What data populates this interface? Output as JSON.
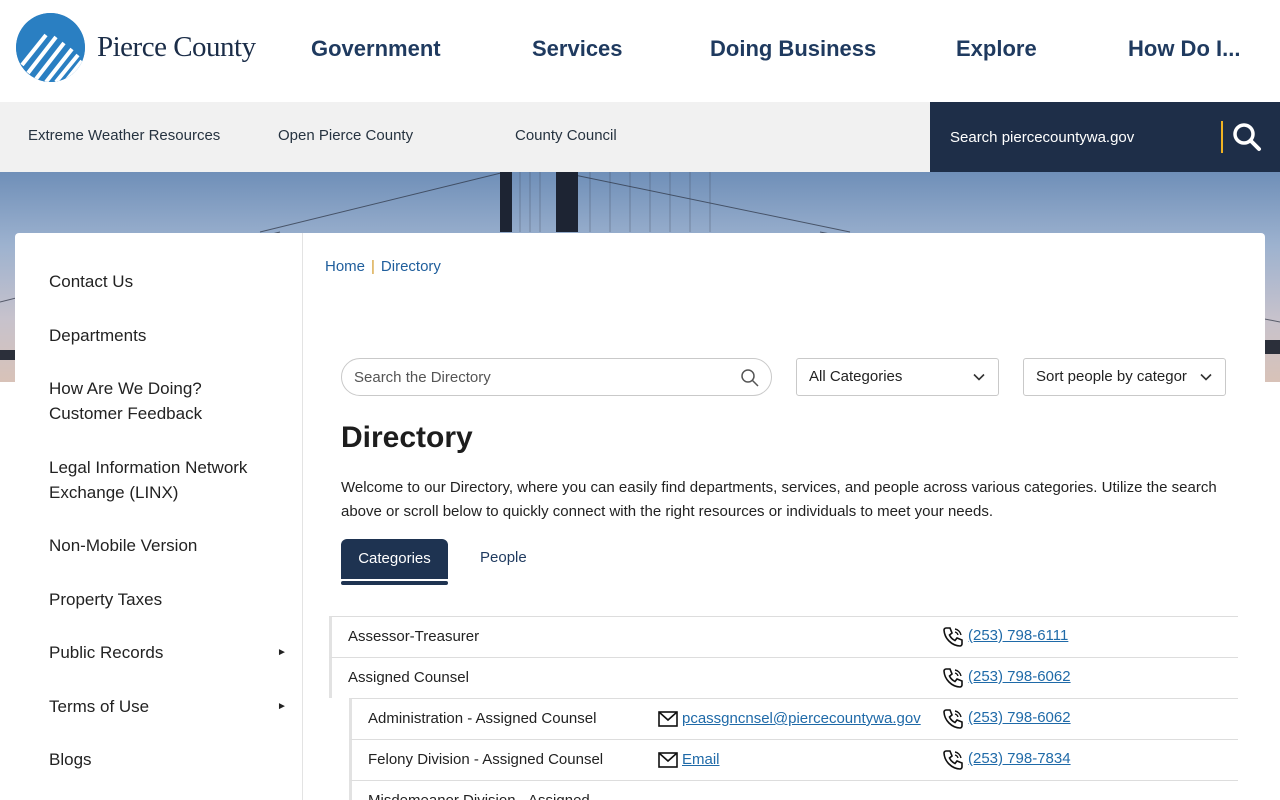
{
  "header": {
    "logo_text": "Pierce County",
    "nav": [
      "Government",
      "Services",
      "Doing Business",
      "Explore",
      "How Do I..."
    ]
  },
  "subbar": {
    "links": [
      "Extreme Weather Resources",
      "Open Pierce County",
      "County Council"
    ],
    "search_placeholder": "Search piercecountywa.gov"
  },
  "sidebar": {
    "items": [
      {
        "label": "Contact Us",
        "has_submenu": false
      },
      {
        "label": "Departments",
        "has_submenu": false
      },
      {
        "label": "How Are We Doing? Customer Feedback",
        "has_submenu": false
      },
      {
        "label": "Legal Information Network Exchange (LINX)",
        "has_submenu": false
      },
      {
        "label": "Non-Mobile Version",
        "has_submenu": false
      },
      {
        "label": "Property Taxes",
        "has_submenu": false
      },
      {
        "label": "Public Records",
        "has_submenu": true
      },
      {
        "label": "Terms of Use",
        "has_submenu": true
      },
      {
        "label": "Blogs",
        "has_submenu": false
      }
    ],
    "caret_glyph": "►"
  },
  "breadcrumb": {
    "home": "Home",
    "separator": "|",
    "current": "Directory"
  },
  "directory": {
    "search_placeholder": "Search the Directory",
    "category_select": "All Categories",
    "sort_select": "Sort people by categor",
    "title": "Directory",
    "intro": "Welcome to our Directory, where you can easily find departments, services, and people across various categories. Utilize the search above or scroll below to quickly connect with the right resources or individuals to meet your needs.",
    "tabs": {
      "categories": "Categories",
      "people": "People"
    },
    "rows": [
      {
        "name": "Assessor-Treasurer",
        "email": "",
        "phone": "(253) 798-6111",
        "sub": false
      },
      {
        "name": "Assigned Counsel",
        "email": "",
        "phone": "(253) 798-6062",
        "sub": false
      },
      {
        "name": "Administration - Assigned Counsel",
        "email": "pcassgncnsel@piercecountywa.gov",
        "phone": "(253) 798-6062",
        "sub": true
      },
      {
        "name": "Felony Division - Assigned Counsel",
        "email": "Email",
        "phone": "(253) 798-7834",
        "sub": true
      },
      {
        "name": "Misdemeanor Division - Assigned",
        "email": "",
        "phone": "",
        "sub": true
      }
    ]
  },
  "colors": {
    "navy": "#1e2e48",
    "link": "#1f6aa8",
    "accent": "#f0b323"
  }
}
